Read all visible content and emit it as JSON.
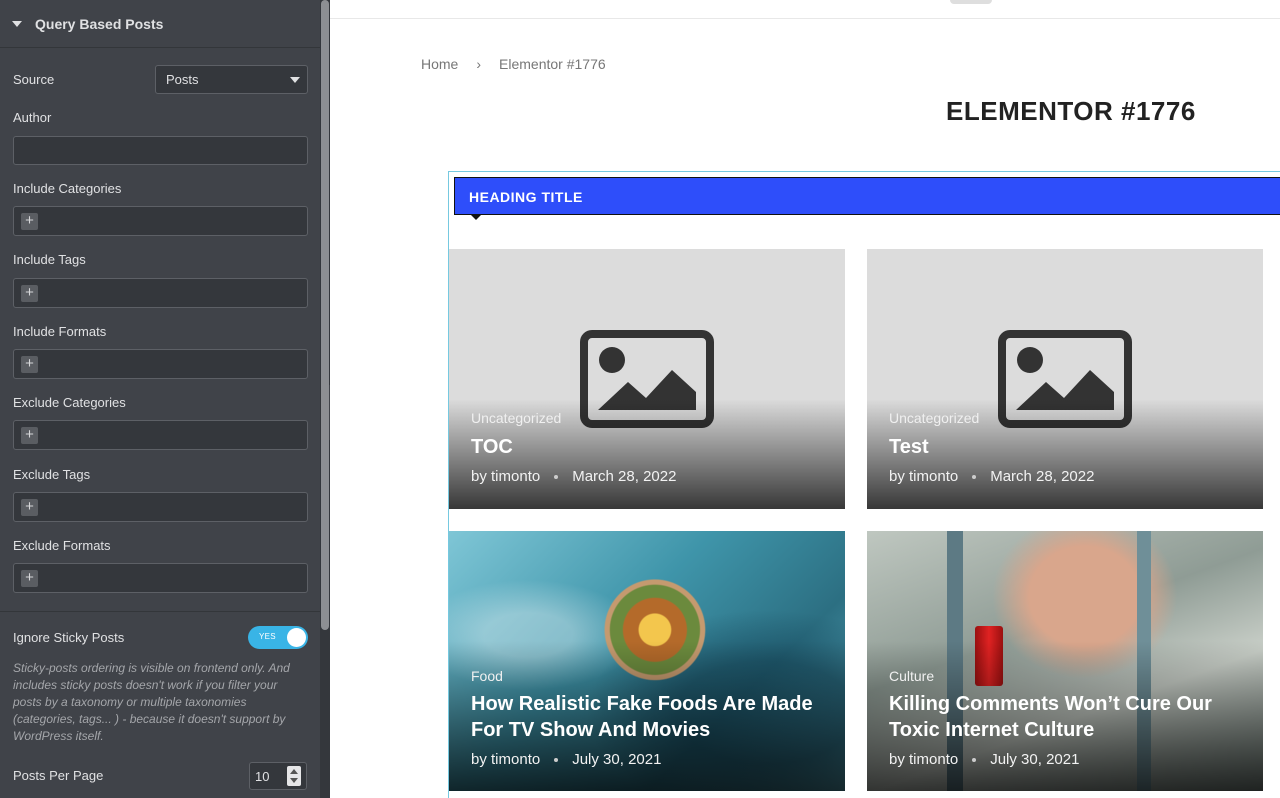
{
  "sidebar": {
    "section_title": "Query Based Posts",
    "source": {
      "label": "Source",
      "value": "Posts"
    },
    "author": {
      "label": "Author",
      "value": ""
    },
    "include_categories": {
      "label": "Include Categories"
    },
    "include_tags": {
      "label": "Include Tags"
    },
    "include_formats": {
      "label": "Include Formats"
    },
    "exclude_categories": {
      "label": "Exclude Categories"
    },
    "exclude_tags": {
      "label": "Exclude Tags"
    },
    "exclude_formats": {
      "label": "Exclude Formats"
    },
    "plus_glyph": "+",
    "ignore_sticky": {
      "label": "Ignore Sticky Posts",
      "toggle_text": "YES",
      "on": true
    },
    "help_text": "Sticky-posts ordering is visible on frontend only. And includes sticky posts doesn't work if you filter your posts by a taxonomy or multiple taxonomies (categories, tags... ) - because it doesn't support by WordPress itself.",
    "posts_per_page": {
      "label": "Posts Per Page",
      "value": "10"
    }
  },
  "preview": {
    "breadcrumb": {
      "home": "Home",
      "separator": "›",
      "current": "Elementor #1776"
    },
    "page_title": "ELEMENTOR #1776",
    "heading_title": "HEADING TITLE",
    "posts": [
      {
        "category": "Uncategorized",
        "title": "TOC",
        "author": "by timonto",
        "date": "March 28, 2022",
        "image": "placeholder-image-icon"
      },
      {
        "category": "Uncategorized",
        "title": "Test",
        "author": "by timonto",
        "date": "March 28, 2022",
        "image": "placeholder-image-icon"
      },
      {
        "category": "Food",
        "title": "How Realistic Fake Foods Are Made For TV Show And Movies",
        "author": "by timonto",
        "date": "July 30, 2021",
        "image": "food-photo"
      },
      {
        "category": "Culture",
        "title": "Killing Comments Won’t Cure Our Toxic Internet Culture",
        "author": "by timonto",
        "date": "July 30, 2021",
        "image": "legs-photo"
      }
    ]
  },
  "colors": {
    "sidebar_bg": "#404349",
    "heading_bar": "#2e4efa",
    "toggle_on": "#39b4e6"
  }
}
